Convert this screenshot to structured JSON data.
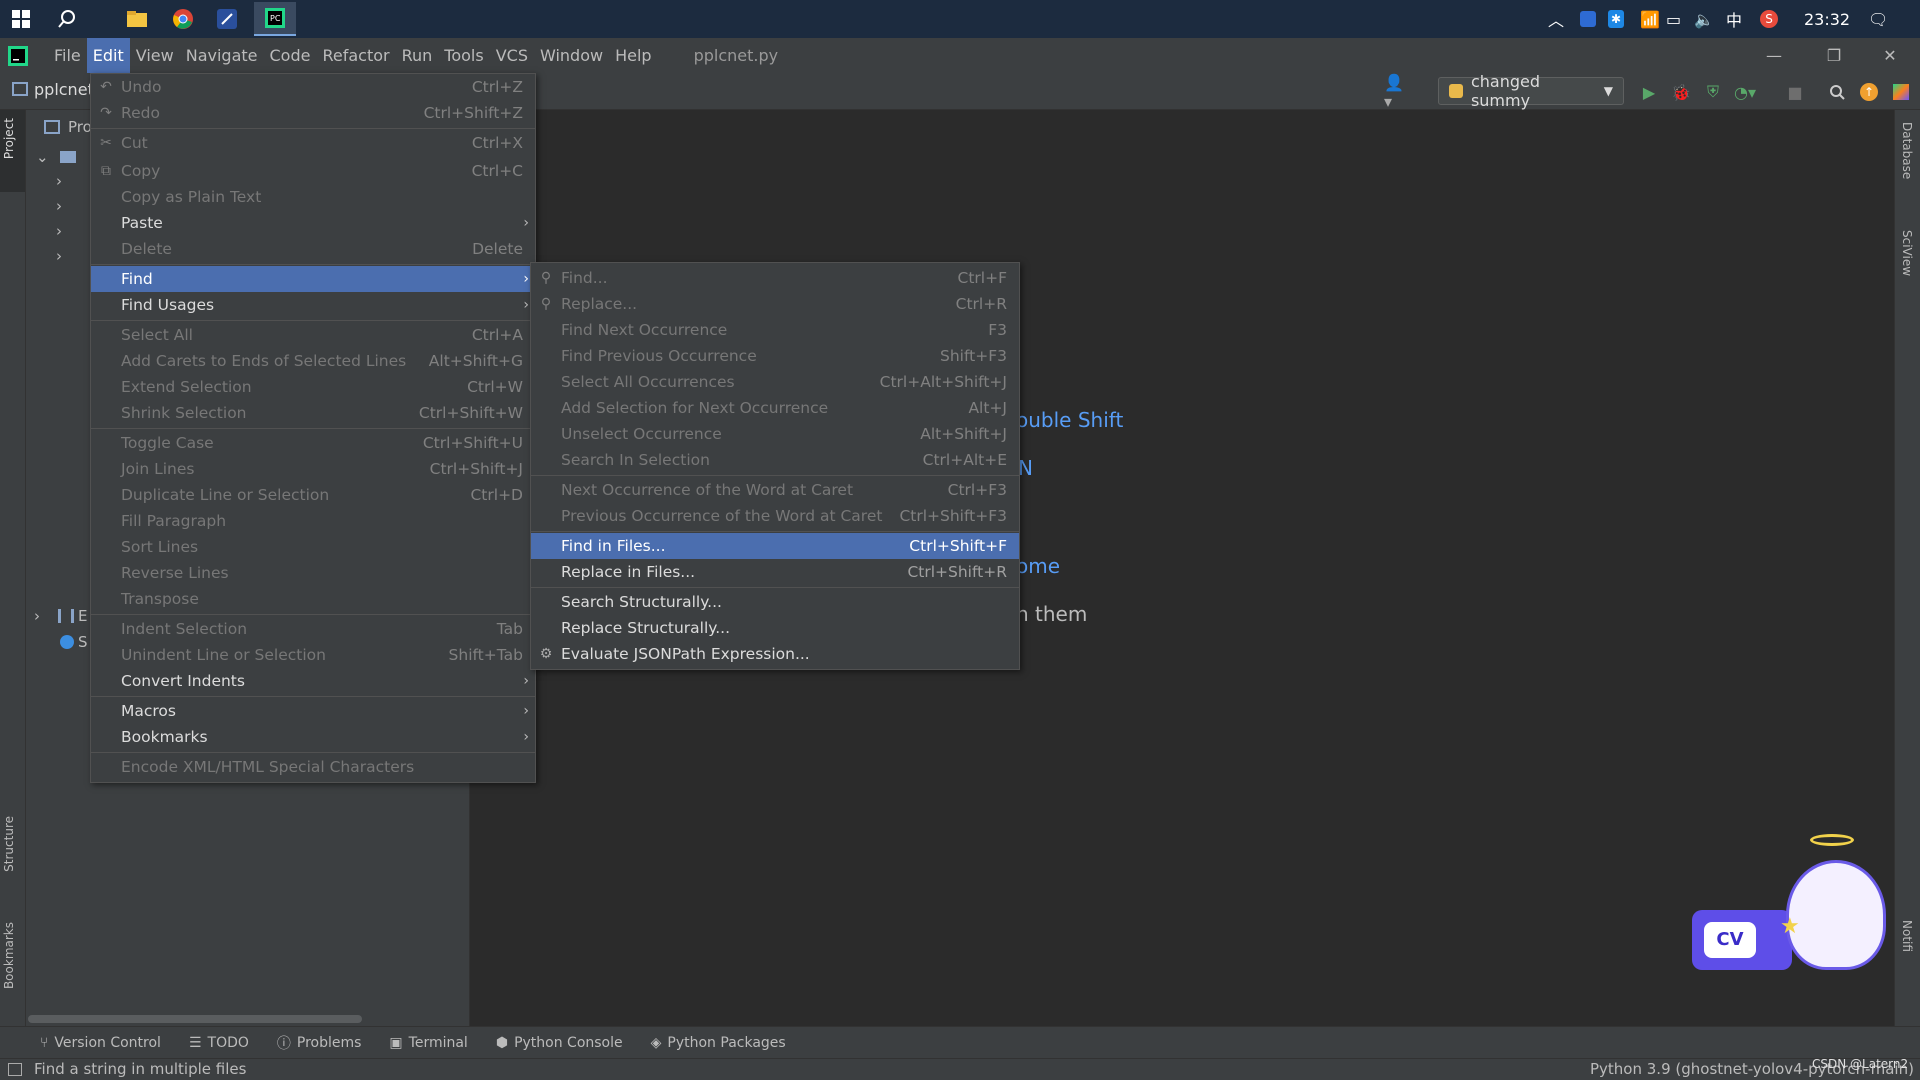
{
  "taskbar": {
    "clock": "23:32",
    "ime": "中"
  },
  "menubar": {
    "items": [
      "File",
      "Edit",
      "View",
      "Navigate",
      "Code",
      "Refactor",
      "Run",
      "Tools",
      "VCS",
      "Window",
      "Help"
    ],
    "file_title": "pplcnet.py"
  },
  "toolbar": {
    "project_name": "pplcnet",
    "run_config": "changed summy"
  },
  "project_panel": {
    "title": "Pro",
    "row_e": "E",
    "row_s": "S"
  },
  "editor_hints": {
    "hint1": "ouble Shift",
    "hint2": "N",
    "hint3": "ome",
    "hint4": "n them"
  },
  "edit_menu": {
    "items": [
      {
        "label": "Undo",
        "shortcut": "Ctrl+Z",
        "enabled": false
      },
      {
        "label": "Redo",
        "shortcut": "Ctrl+Shift+Z",
        "enabled": false
      },
      {
        "label": "Cut",
        "shortcut": "Ctrl+X",
        "enabled": false
      },
      {
        "label": "Copy",
        "shortcut": "Ctrl+C",
        "enabled": false
      },
      {
        "label": "Copy as Plain Text",
        "shortcut": "",
        "enabled": false
      },
      {
        "label": "Paste",
        "shortcut": "",
        "enabled": true,
        "submenu": true
      },
      {
        "label": "Delete",
        "shortcut": "Delete",
        "enabled": false
      },
      {
        "label": "Find",
        "shortcut": "",
        "enabled": true,
        "submenu": true,
        "selected": true
      },
      {
        "label": "Find Usages",
        "shortcut": "",
        "enabled": true,
        "submenu": true
      },
      {
        "label": "Select All",
        "shortcut": "Ctrl+A",
        "enabled": false
      },
      {
        "label": "Add Carets to Ends of Selected Lines",
        "shortcut": "Alt+Shift+G",
        "enabled": false
      },
      {
        "label": "Extend Selection",
        "shortcut": "Ctrl+W",
        "enabled": false
      },
      {
        "label": "Shrink Selection",
        "shortcut": "Ctrl+Shift+W",
        "enabled": false
      },
      {
        "label": "Toggle Case",
        "shortcut": "Ctrl+Shift+U",
        "enabled": false
      },
      {
        "label": "Join Lines",
        "shortcut": "Ctrl+Shift+J",
        "enabled": false
      },
      {
        "label": "Duplicate Line or Selection",
        "shortcut": "Ctrl+D",
        "enabled": false
      },
      {
        "label": "Fill Paragraph",
        "shortcut": "",
        "enabled": false
      },
      {
        "label": "Sort Lines",
        "shortcut": "",
        "enabled": false
      },
      {
        "label": "Reverse Lines",
        "shortcut": "",
        "enabled": false
      },
      {
        "label": "Transpose",
        "shortcut": "",
        "enabled": false
      },
      {
        "label": "Indent Selection",
        "shortcut": "Tab",
        "enabled": false
      },
      {
        "label": "Unindent Line or Selection",
        "shortcut": "Shift+Tab",
        "enabled": false
      },
      {
        "label": "Convert Indents",
        "shortcut": "",
        "enabled": true,
        "submenu": true
      },
      {
        "label": "Macros",
        "shortcut": "",
        "enabled": true,
        "submenu": true
      },
      {
        "label": "Bookmarks",
        "shortcut": "",
        "enabled": true,
        "submenu": true
      },
      {
        "label": "Encode XML/HTML Special Characters",
        "shortcut": "",
        "enabled": false
      }
    ]
  },
  "find_submenu": {
    "items": [
      {
        "label": "Find...",
        "shortcut": "Ctrl+F",
        "enabled": false
      },
      {
        "label": "Replace...",
        "shortcut": "Ctrl+R",
        "enabled": false
      },
      {
        "label": "Find Next Occurrence",
        "shortcut": "F3",
        "enabled": false
      },
      {
        "label": "Find Previous Occurrence",
        "shortcut": "Shift+F3",
        "enabled": false
      },
      {
        "label": "Select All Occurrences",
        "shortcut": "Ctrl+Alt+Shift+J",
        "enabled": false
      },
      {
        "label": "Add Selection for Next Occurrence",
        "shortcut": "Alt+J",
        "enabled": false
      },
      {
        "label": "Unselect Occurrence",
        "shortcut": "Alt+Shift+J",
        "enabled": false
      },
      {
        "label": "Search In Selection",
        "shortcut": "Ctrl+Alt+E",
        "enabled": false
      },
      {
        "label": "Next Occurrence of the Word at Caret",
        "shortcut": "Ctrl+F3",
        "enabled": false
      },
      {
        "label": "Previous Occurrence of the Word at Caret",
        "shortcut": "Ctrl+Shift+F3",
        "enabled": false
      },
      {
        "label": "Find in Files...",
        "shortcut": "Ctrl+Shift+F",
        "enabled": true,
        "selected": true
      },
      {
        "label": "Replace in Files...",
        "shortcut": "Ctrl+Shift+R",
        "enabled": true
      },
      {
        "label": "Search Structurally...",
        "shortcut": "",
        "enabled": true
      },
      {
        "label": "Replace Structurally...",
        "shortcut": "",
        "enabled": true
      },
      {
        "label": "Evaluate JSONPath Expression...",
        "shortcut": "",
        "enabled": true
      }
    ]
  },
  "side_tabs": {
    "project": "Project",
    "structure": "Structure",
    "bookmarks": "Bookmarks",
    "database": "Database",
    "sciview": "SciView",
    "notifications": "Notifi"
  },
  "bottom_tabs": [
    "Version Control",
    "TODO",
    "Problems",
    "Terminal",
    "Python Console",
    "Python Packages"
  ],
  "status": {
    "message": "Find a string in multiple files",
    "interpreter": "Python 3.9 (ghostnet-yolov4-pytorch-main)",
    "watermark": "CSDN @Latern2"
  },
  "colors": {
    "accent": "#4b6eaf",
    "link": "#589df6",
    "panel": "#3c3f41",
    "editor": "#2b2b2b"
  }
}
